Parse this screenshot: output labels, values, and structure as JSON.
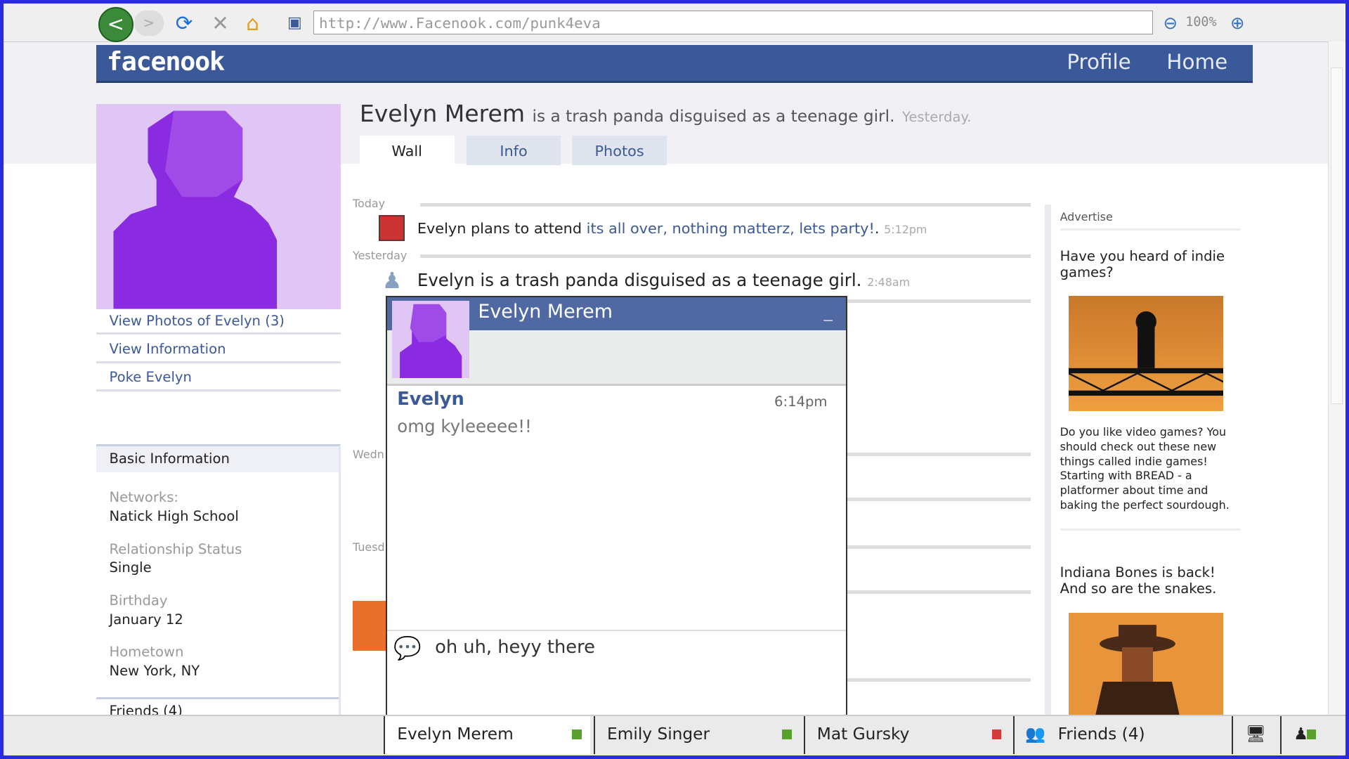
{
  "browser": {
    "url": "http://www.Facenook.com/punk4eva",
    "zoom": "100%",
    "back": "<",
    "forward": ">"
  },
  "site": {
    "logo": "facenook",
    "nav": [
      "Profile",
      "Home"
    ]
  },
  "profile": {
    "name": "Evelyn Merem",
    "status": "is a trash panda disguised as a teenage girl.",
    "status_time": "Yesterday.",
    "links": [
      "View Photos of Evelyn (3)",
      "View Information",
      "Poke Evelyn"
    ],
    "basic": {
      "title": "Basic Information",
      "fields": [
        {
          "label": "Networks:",
          "value": "Natick High School"
        },
        {
          "label": "Relationship Status",
          "value": "Single"
        },
        {
          "label": "Birthday",
          "value": "January 12"
        },
        {
          "label": "Hometown",
          "value": "New York, NY"
        }
      ],
      "friends": "Friends (4)"
    }
  },
  "tabs": [
    "Wall",
    "Info",
    "Photos"
  ],
  "wall": {
    "days": [
      "Today",
      "Yesterday",
      "Wedn",
      "Tuesd"
    ],
    "items": [
      {
        "text": "Evelyn plans to attend ",
        "link": "its all over, nothing matterz, lets party!",
        "suffix": ".",
        "time": "5:12pm"
      },
      {
        "text": "Evelyn is a trash panda disguised as a teenage girl.",
        "time": "2:48am"
      }
    ]
  },
  "ads": {
    "title": "Advertise",
    "items": [
      {
        "heading": "Have you heard of indie games?",
        "body": "Do you like video games? You should check out these new things called indie games! Starting with BREAD - a platformer about time and baking the perfect sourdough."
      },
      {
        "heading": "Indiana Bones is back! And so are the snakes."
      }
    ]
  },
  "chat": {
    "name": "Evelyn Merem",
    "minimize": "_",
    "messages": [
      {
        "sender": "Evelyn",
        "time": "6:14pm",
        "text": "omg kyleeeee!!"
      }
    ],
    "draft": "oh uh, heyy there"
  },
  "bottom": {
    "tabs": [
      {
        "name": "Evelyn Merem",
        "status": "online"
      },
      {
        "name": "Emily Singer",
        "status": "online"
      },
      {
        "name": "Mat Gursky",
        "status": "offline"
      }
    ],
    "friends": "Friends (4)",
    "colors": {
      "online": "#5aa02c",
      "offline": "#d43a3a"
    }
  }
}
